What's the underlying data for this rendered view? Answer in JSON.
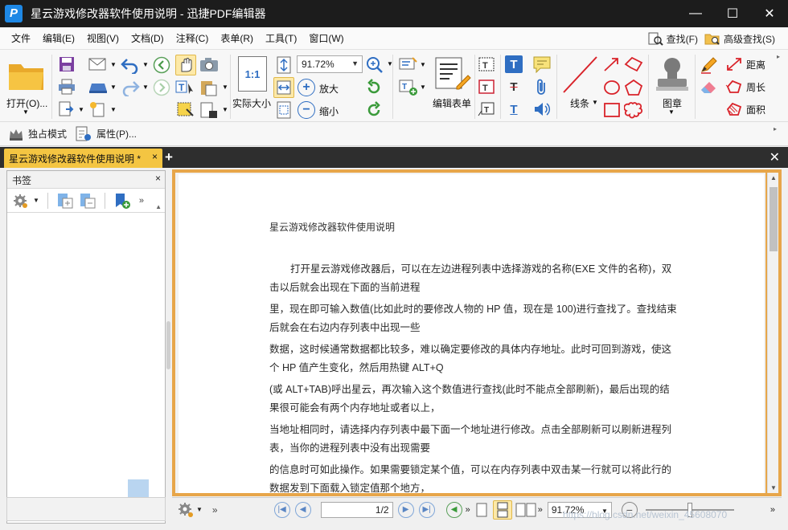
{
  "window": {
    "title": "星云游戏修改器软件使用说明 - 迅捷PDF编辑器",
    "logo_letter": "P",
    "minimize": "—",
    "maximize": "☐",
    "close": "✕"
  },
  "menu": {
    "items": [
      "文件",
      "编辑(E)",
      "视图(V)",
      "文档(D)",
      "注释(C)",
      "表单(R)",
      "工具(T)",
      "窗口(W)"
    ],
    "find_label": "查找(F)",
    "adv_find_label": "高级查找(S)"
  },
  "ribbon": {
    "open_label": "打开(O)...",
    "actual_size_label": "实际大小",
    "zoom_value": "91.72%",
    "zoom_in_label": "放大",
    "zoom_out_label": "缩小",
    "edit_form_label": "编辑表单",
    "line_label": "线条",
    "stamp_label": "图章",
    "distance_label": "距离",
    "perimeter_label": "周长",
    "area_label": "面积",
    "actual_size_glyph": "1:1"
  },
  "toolbar2": {
    "exclusive_mode": "独占模式",
    "properties": "属性(P)..."
  },
  "tabs": {
    "active_tab": "星云游戏修改器软件使用说明 *",
    "close": "×",
    "add": "+",
    "close_all": "✕"
  },
  "bookmark_panel": {
    "title": "书签",
    "close": "×"
  },
  "document": {
    "title": "星云游戏修改器软件使用说明",
    "paragraphs": [
      "打开星云游戏修改器后，可以在左边进程列表中选择游戏的名称(EXE 文件的名称)，双击以后就会出现在下面的当前进程",
      "里，现在即可输入数值(比如此时的要修改人物的 HP 值，现在是 100)进行查找了。查找结束后就会在右边内存列表中出现一些",
      "数据，这时候通常数据都比较多，难以确定要修改的具体内存地址。此时可回到游戏，使这个 HP 值产生变化，然后用热键 ALT+Q",
      "(或 ALT+TAB)呼出星云，再次输入这个数值进行查找(此时不能点全部刷新)，最后出现的结果很可能会有两个内存地址或者以上，",
      "当地址相同时，请选择内存列表中最下面一个地址进行修改。点击全部刷新可以刷新进程列表，当你的进程列表中没有出现需要",
      "的信息时可如此操作。如果需要锁定某个值，可以在内存列表中双击某一行就可以将此行的数据发到下面载入锁定值那个地方，"
    ]
  },
  "statusbar": {
    "page_display": "1/2",
    "zoom_value": "91.72%"
  },
  "watermark": "https://blog.csdn.net/weixin_45608070",
  "colors": {
    "titlebar_bg": "#1c1c1c",
    "active_tab": "#f4c542",
    "doc_frame": "#e7a64a",
    "accent_blue": "#1e88e5",
    "accent_red": "#d9232a"
  }
}
